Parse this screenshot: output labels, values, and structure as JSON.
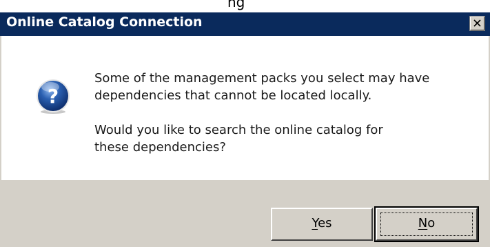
{
  "background_fragment": "ng",
  "dialog": {
    "title": "Online Catalog Connection",
    "message_line1": "Some of the management packs you select may have",
    "message_line2": "dependencies that cannot be located locally.",
    "message_line3": "Would you like to search the online catalog for",
    "message_line4": "these dependencies?",
    "icon": "question-icon"
  },
  "buttons": {
    "yes_mnemonic": "Y",
    "yes_rest": "es",
    "no_mnemonic": "N",
    "no_rest": "o"
  },
  "colors": {
    "titlebar": "#0a2a5c",
    "face": "#d4d0c8",
    "icon_blue": "#2a5fb0"
  }
}
